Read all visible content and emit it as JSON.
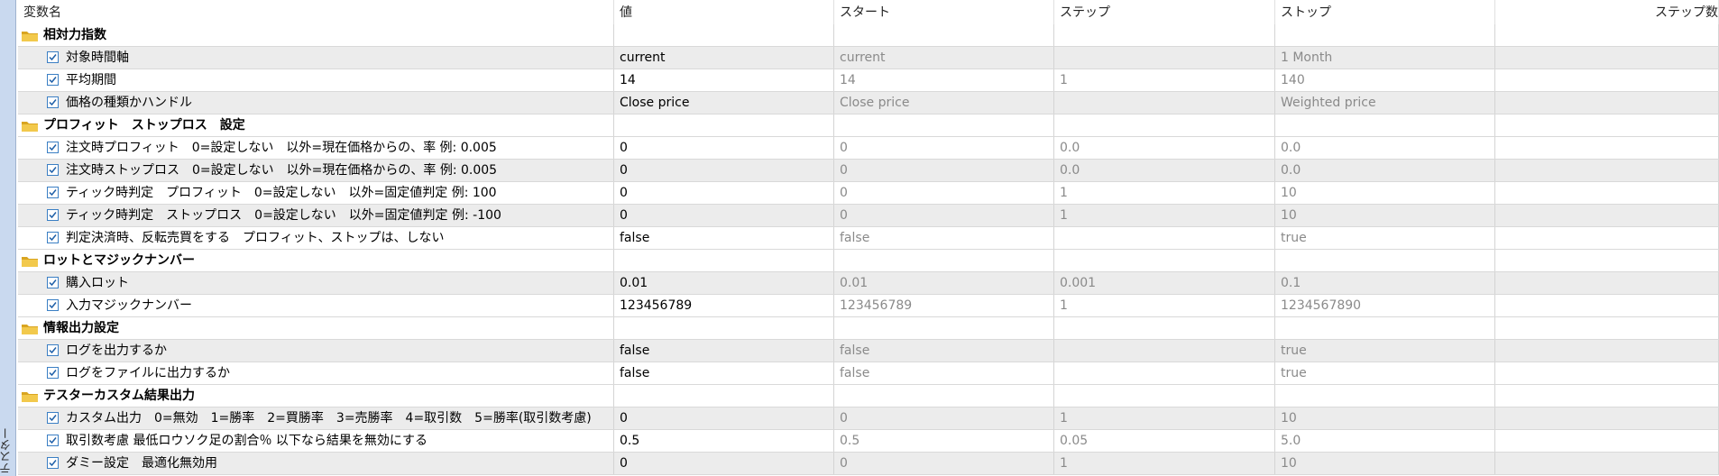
{
  "side_tab": {
    "label": "テスター"
  },
  "columns": [
    "変数名",
    "値",
    "スタート",
    "ステップ",
    "ストップ",
    "ステップ数"
  ],
  "rows": [
    {
      "type": "group",
      "name": "相対力指数"
    },
    {
      "type": "param",
      "name": "対象時間軸",
      "value": "current",
      "start": "current",
      "step": "",
      "stop": "1 Month"
    },
    {
      "type": "param",
      "name": "平均期間",
      "value": "14",
      "start": "14",
      "step": "1",
      "stop": "140"
    },
    {
      "type": "param",
      "name": "価格の種類かハンドル",
      "value": "Close price",
      "start": "Close price",
      "step": "",
      "stop": "Weighted price"
    },
    {
      "type": "group",
      "name": "プロフィット　ストップロス　設定"
    },
    {
      "type": "param",
      "name": "注文時プロフィット　0=設定しない　以外=現在価格からの、率 例: 0.005",
      "value": "0",
      "start": "0",
      "step": "0.0",
      "stop": "0.0"
    },
    {
      "type": "param",
      "name": "注文時ストップロス　0=設定しない　以外=現在価格からの、率 例: 0.005",
      "value": "0",
      "start": "0",
      "step": "0.0",
      "stop": "0.0"
    },
    {
      "type": "param",
      "name": "ティック時判定　プロフィット　0=設定しない　以外=固定値判定 例: 100",
      "value": "0",
      "start": "0",
      "step": "1",
      "stop": "10"
    },
    {
      "type": "param",
      "name": "ティック時判定　ストップロス　0=設定しない　以外=固定値判定 例: -100",
      "value": "0",
      "start": "0",
      "step": "1",
      "stop": "10"
    },
    {
      "type": "param",
      "name": "判定決済時、反転売買をする　プロフィット、ストップは、しない",
      "value": "false",
      "start": "false",
      "step": "",
      "stop": "true"
    },
    {
      "type": "group",
      "name": "ロットとマジックナンバー"
    },
    {
      "type": "param",
      "name": "購入ロット",
      "value": "0.01",
      "start": "0.01",
      "step": "0.001",
      "stop": "0.1"
    },
    {
      "type": "param",
      "name": "入力マジックナンバー",
      "value": "123456789",
      "start": "123456789",
      "step": "1",
      "stop": "1234567890"
    },
    {
      "type": "group",
      "name": "情報出力設定"
    },
    {
      "type": "param",
      "name": "ログを出力するか",
      "value": "false",
      "start": "false",
      "step": "",
      "stop": "true"
    },
    {
      "type": "param",
      "name": "ログをファイルに出力するか",
      "value": "false",
      "start": "false",
      "step": "",
      "stop": "true"
    },
    {
      "type": "group",
      "name": "テスターカスタム結果出力"
    },
    {
      "type": "param",
      "name": "カスタム出力　0=無効　1=勝率　2=買勝率　3=売勝率　4=取引数　5=勝率(取引数考慮)",
      "value": "0",
      "start": "0",
      "step": "1",
      "stop": "10"
    },
    {
      "type": "param",
      "name": "取引数考慮 最低ロウソク足の割合％ 以下なら結果を無効にする",
      "value": "0.5",
      "start": "0.5",
      "step": "0.05",
      "stop": "5.0"
    },
    {
      "type": "param",
      "name": "ダミー設定　最適化無効用",
      "value": "0",
      "start": "0",
      "step": "1",
      "stop": "10"
    }
  ],
  "colors": {
    "folder": "#f2c94c",
    "folder_dark": "#d9a521",
    "checkbox_border": "#3b7fc4",
    "check": "#1e5fa8",
    "row_alt": "#ececec",
    "side_tab": "#c9d9ef"
  },
  "icons": {
    "group": "folder-icon",
    "param": "checkbox-checked-icon"
  }
}
